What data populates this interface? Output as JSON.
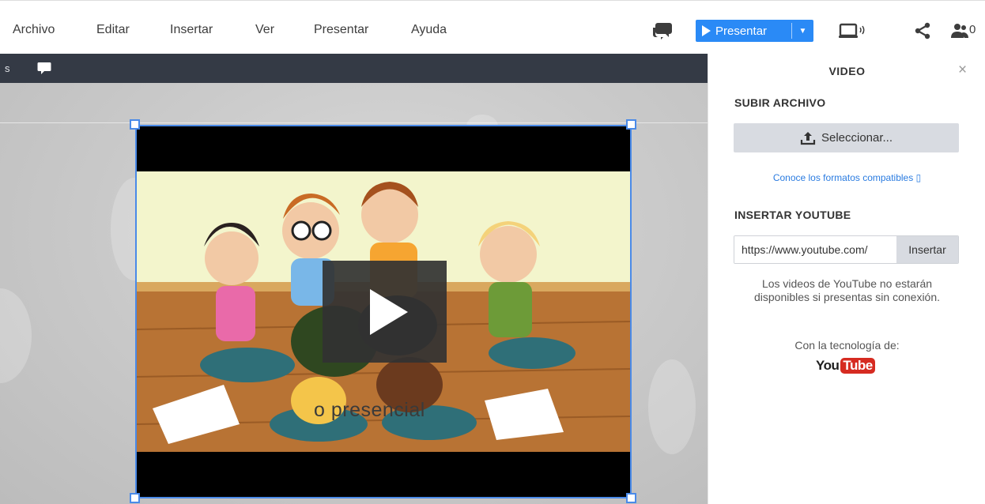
{
  "menu": {
    "items": [
      {
        "label": "Archivo"
      },
      {
        "label": "Editar"
      },
      {
        "label": "Insertar"
      },
      {
        "label": "Ver"
      },
      {
        "label": "Presentar"
      },
      {
        "label": "Ayuda"
      }
    ]
  },
  "toolbar": {
    "present_label": "Presentar",
    "present_dropdown": "▼",
    "collaborators_count": "0",
    "icons": [
      "comments-icon",
      "play-icon",
      "screen-cast-icon",
      "share-icon",
      "collaborators-icon"
    ],
    "accent_color": "#2a8af6"
  },
  "darkbar": {
    "partial_label": "s"
  },
  "canvas": {
    "video_caption": "o presencial"
  },
  "panel": {
    "title": "VIDEO",
    "close": "×",
    "upload_heading": "SUBIR ARCHIVO",
    "upload_button": "Seleccionar...",
    "formats_link": "Conoce los formatos compatibles ▯",
    "youtube_heading": "INSERTAR YOUTUBE",
    "youtube_input_value": "https://www.youtube.com/",
    "youtube_insert_button": "Insertar",
    "youtube_note": "Los videos de YouTube no estarán disponibles si presentas sin conexión.",
    "powered_by": "Con la tecnología de:",
    "logo_you": "You",
    "logo_tube": "Tube"
  }
}
